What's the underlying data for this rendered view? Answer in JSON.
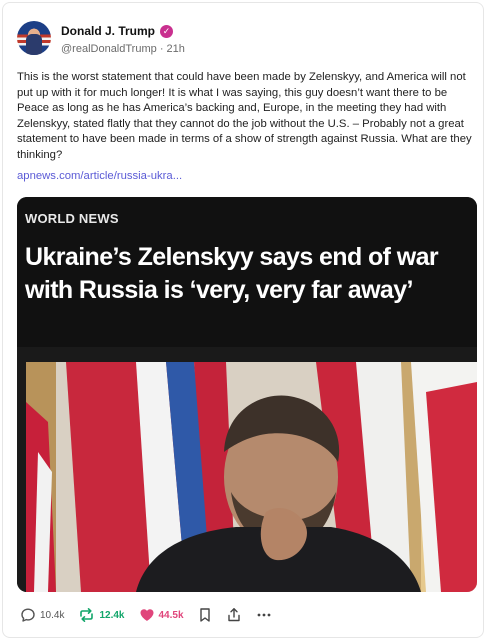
{
  "author": {
    "name": "Donald J. Trump",
    "handle": "@realDonaldTrump",
    "separator": "·",
    "time": "21h"
  },
  "post": {
    "text": "This is the worst statement that could have been made by Zelenskyy, and America will not put up with it for much longer! It is what I was saying, this guy doesn’t want there to be Peace as long as he has America’s backing and, Europe, in the meeting they had with Zelenskyy, stated flatly that they cannot do the job without the U.S. – Probably not a great statement to have been made in terms of a show of strength against Russia. What are they thinking?",
    "link": "apnews.com/article/russia-ukra..."
  },
  "card": {
    "kicker": "WORLD NEWS",
    "headline": "Ukraine’s Zelenskyy says end of war with Russia is ‘very, very far away’"
  },
  "actions": {
    "replies": "10.4k",
    "reposts": "12.4k",
    "likes": "44.5k"
  },
  "colors": {
    "verified": "#c9308f",
    "link": "#5b5bd6",
    "repost": "#12a66a",
    "like": "#e0457b"
  },
  "icons": [
    "verified-badge-icon",
    "reply-icon",
    "repost-icon",
    "like-icon",
    "bookmark-icon",
    "share-icon",
    "more-icon"
  ]
}
